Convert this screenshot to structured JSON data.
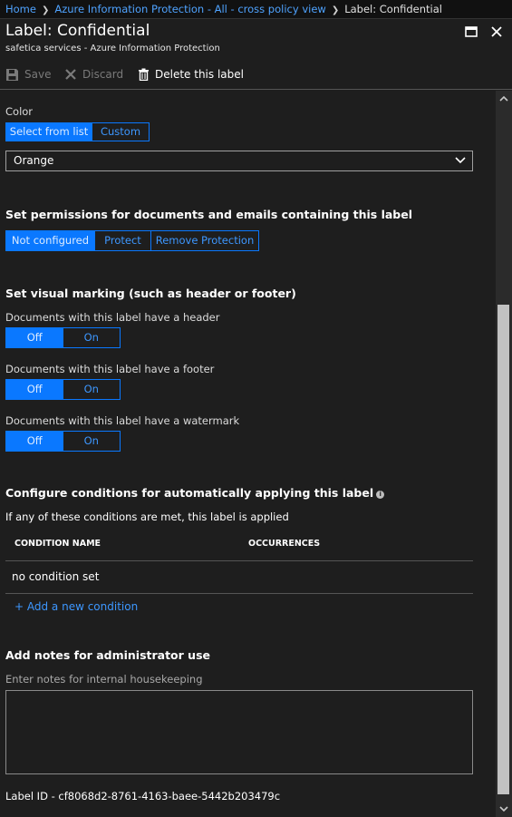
{
  "breadcrumb": {
    "items": [
      "Home",
      "Azure Information Protection - All - cross policy view",
      "Label: Confidential"
    ]
  },
  "blade": {
    "title": "Label: Confidential",
    "subtitle": "safetica services - Azure Information Protection"
  },
  "toolbar": {
    "save_label": "Save",
    "discard_label": "Discard",
    "delete_label": "Delete this label"
  },
  "color": {
    "label": "Color",
    "options": [
      "Select from list",
      "Custom"
    ],
    "selected_option": "Select from list",
    "dropdown_value": "Orange"
  },
  "permissions": {
    "heading": "Set permissions for documents and emails containing this label",
    "options": [
      "Not configured",
      "Protect",
      "Remove Protection"
    ],
    "selected_option": "Not configured"
  },
  "visual_marking": {
    "heading": "Set visual marking (such as header or footer)",
    "rows": [
      {
        "label": "Documents with this label have a header",
        "off": "Off",
        "on": "On",
        "selected": "Off"
      },
      {
        "label": "Documents with this label have a footer",
        "off": "Off",
        "on": "On",
        "selected": "Off"
      },
      {
        "label": "Documents with this label have a watermark",
        "off": "Off",
        "on": "On",
        "selected": "Off"
      }
    ]
  },
  "conditions": {
    "heading": "Configure conditions for automatically applying this label",
    "description": "If any of these conditions are met, this label is applied",
    "columns": [
      "CONDITION NAME",
      "OCCURRENCES"
    ],
    "empty_row": "no condition set",
    "add_link": "+ Add a new condition"
  },
  "notes": {
    "heading": "Add notes for administrator use",
    "label": "Enter notes for internal housekeeping",
    "value": ""
  },
  "footer": {
    "label_id": "Label ID - cf8068d2-8761-4163-baee-5442b203479c"
  },
  "colors": {
    "accent": "#0a78ff",
    "link": "#3d97ff",
    "background": "#1e1e1e"
  }
}
